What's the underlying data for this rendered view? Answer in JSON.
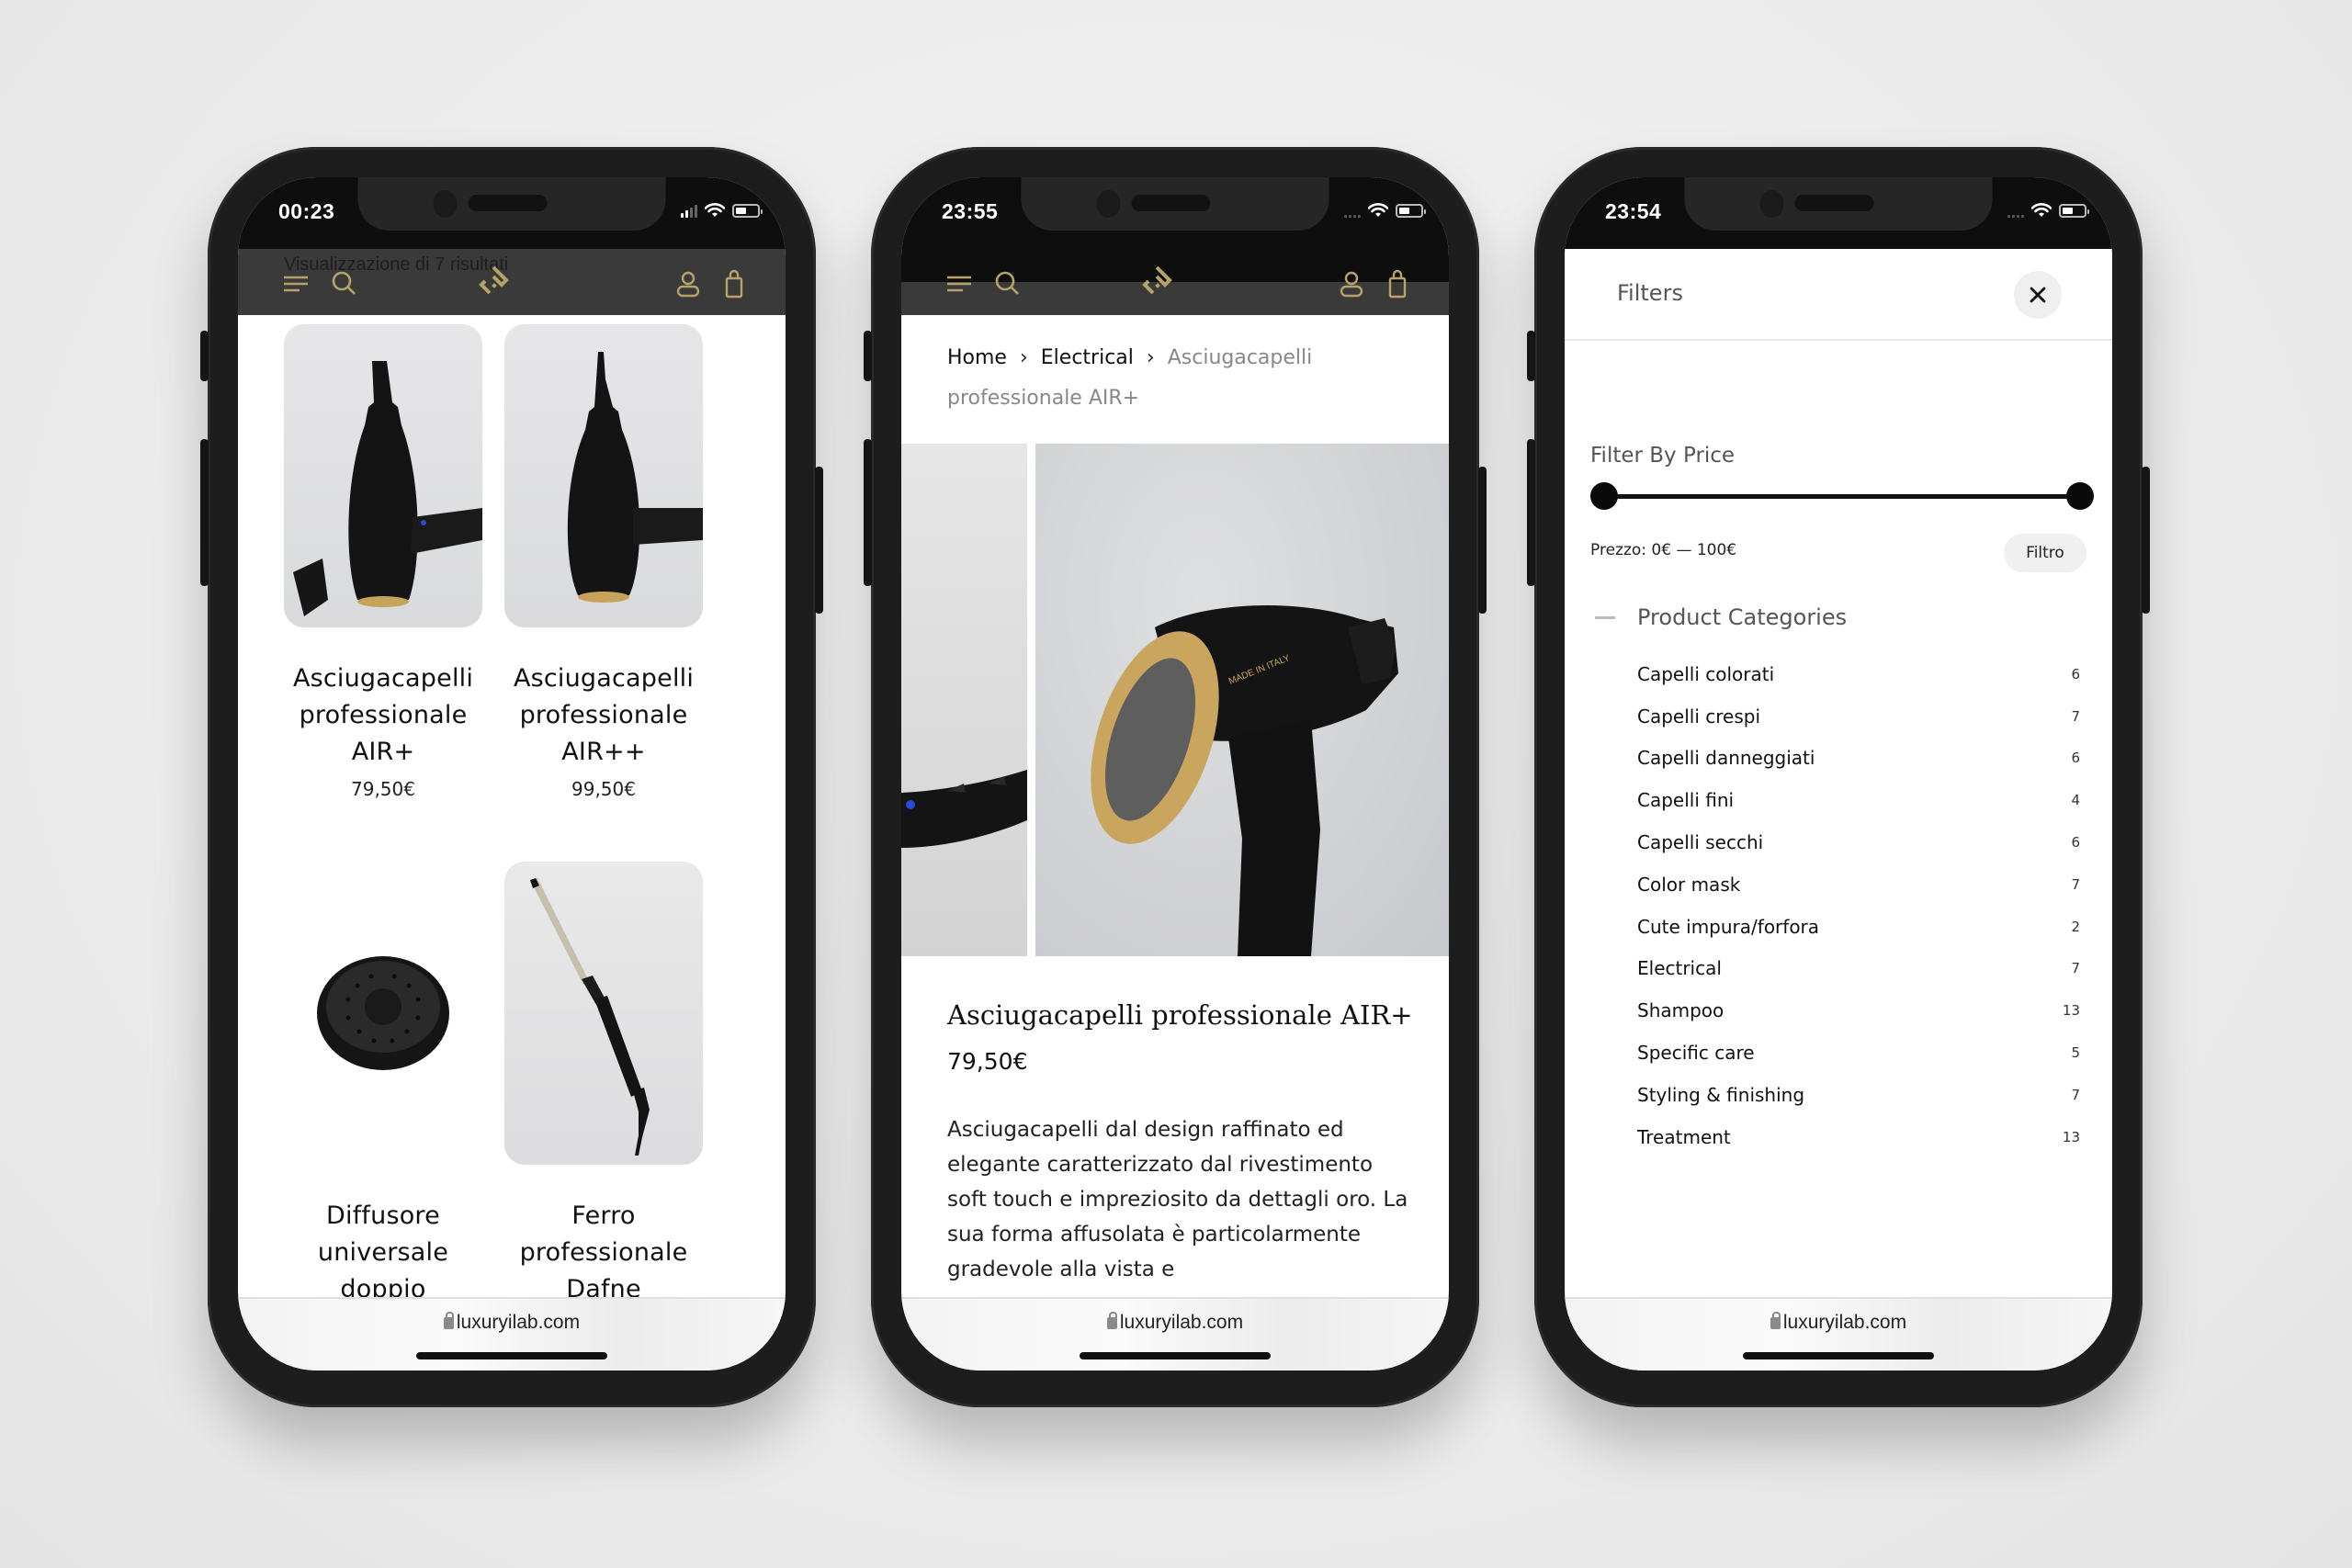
{
  "brand": {
    "accent": "#b5a46a",
    "url": "luxuryilab.com"
  },
  "phones": [
    {
      "time": "00:23",
      "signal": "bars",
      "overlay_text": "Visualizzazione di 7 risultati",
      "products": [
        {
          "title": "Asciugacapelli professionale AIR+",
          "price": "79,50€"
        },
        {
          "title": "Asciugacapelli professionale AIR++",
          "price": "99,50€"
        },
        {
          "title": "Diffusore universale doppio",
          "price": ""
        },
        {
          "title": "Ferro professionale Dafne",
          "price": ""
        }
      ]
    },
    {
      "time": "23:55",
      "signal": "dots",
      "breadcrumb": [
        "Home",
        "Electrical",
        "Asciugacapelli professionale AIR+"
      ],
      "product": {
        "title": "Asciugacapelli professionale AIR+",
        "price": "79,50€",
        "description": "Asciugacapelli dal design raffinato ed elegante caratterizzato dal rivestimento soft touch e impreziosito da dettagli oro. La sua forma affusolata è particolarmente gradevole alla vista e",
        "image_label": "MADE IN ITALY"
      }
    },
    {
      "time": "23:54",
      "signal": "dots",
      "filters": {
        "title": "Filters",
        "price_label": "Filter By Price",
        "price_min": 0,
        "price_max": 100,
        "range_low_fraction": 0,
        "range_high_fraction": 1,
        "price_text": "Prezzo: 0€ — 100€",
        "apply_label": "Filtro",
        "categories_label": "Product Categories",
        "categories": [
          {
            "name": "Capelli colorati",
            "count": "6"
          },
          {
            "name": "Capelli crespi",
            "count": "7"
          },
          {
            "name": "Capelli danneggiati",
            "count": "6"
          },
          {
            "name": "Capelli fini",
            "count": "4"
          },
          {
            "name": "Capelli secchi",
            "count": "6"
          },
          {
            "name": "Color mask",
            "count": "7"
          },
          {
            "name": "Cute impura/forfora",
            "count": "2"
          },
          {
            "name": "Electrical",
            "count": "7"
          },
          {
            "name": "Shampoo",
            "count": "13"
          },
          {
            "name": "Specific care",
            "count": "5"
          },
          {
            "name": "Styling & finishing",
            "count": "7"
          },
          {
            "name": "Treatment",
            "count": "13"
          }
        ]
      }
    }
  ]
}
